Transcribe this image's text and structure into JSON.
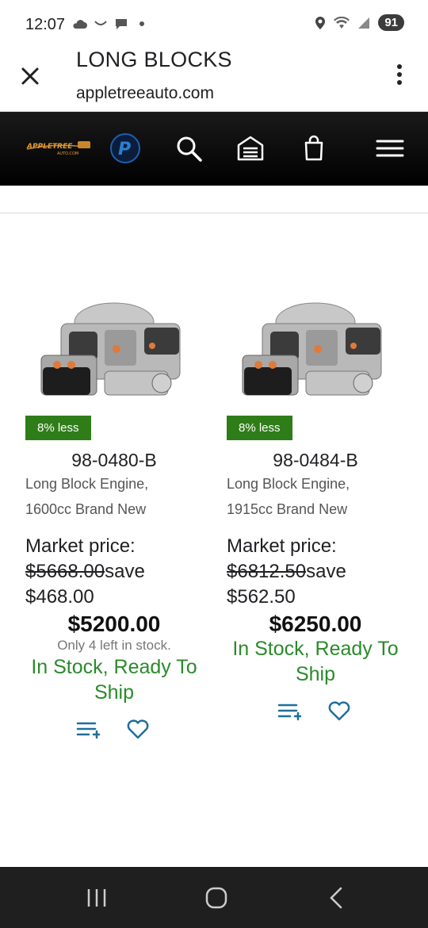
{
  "status_bar": {
    "time": "12:07",
    "battery": "91"
  },
  "app_bar": {
    "title": "LONG BLOCKS",
    "url": "appletreeauto.com"
  },
  "site_nav": {
    "logo_text": "APPLETREE AUTO.COM"
  },
  "products": [
    {
      "badge": "8% less",
      "sku": "98-0480-B",
      "desc_line1": "Long Block Engine,",
      "desc_line2": "1600cc Brand New",
      "market_label": "Market price:",
      "original_price": "$5668.00",
      "save_label": "save",
      "save_amount": "$468.00",
      "price": "$5200.00",
      "stock_left": "Only 4 left in stock.",
      "stock_line1": "In Stock, Ready To",
      "stock_line2": "Ship"
    },
    {
      "badge": "8% less",
      "sku": "98-0484-B",
      "desc_line1": "Long Block Engine,",
      "desc_line2": "1915cc Brand New",
      "market_label": "Market price:",
      "original_price": "$6812.50",
      "save_label": "save",
      "save_amount": "$562.50",
      "price": "$6250.00",
      "stock_line1": "In Stock, Ready To",
      "stock_line2": "Ship"
    }
  ],
  "colors": {
    "badge_bg": "#2f7d18",
    "in_stock": "#2b8a2b",
    "action_icon": "#1e6f9c",
    "navbar_bg": "#000000"
  },
  "icons": [
    "close-icon",
    "more-vert-icon",
    "paypal-icon",
    "search-icon",
    "garage-icon",
    "cart-icon",
    "hamburger-icon",
    "add-to-list-icon",
    "heart-icon"
  ]
}
